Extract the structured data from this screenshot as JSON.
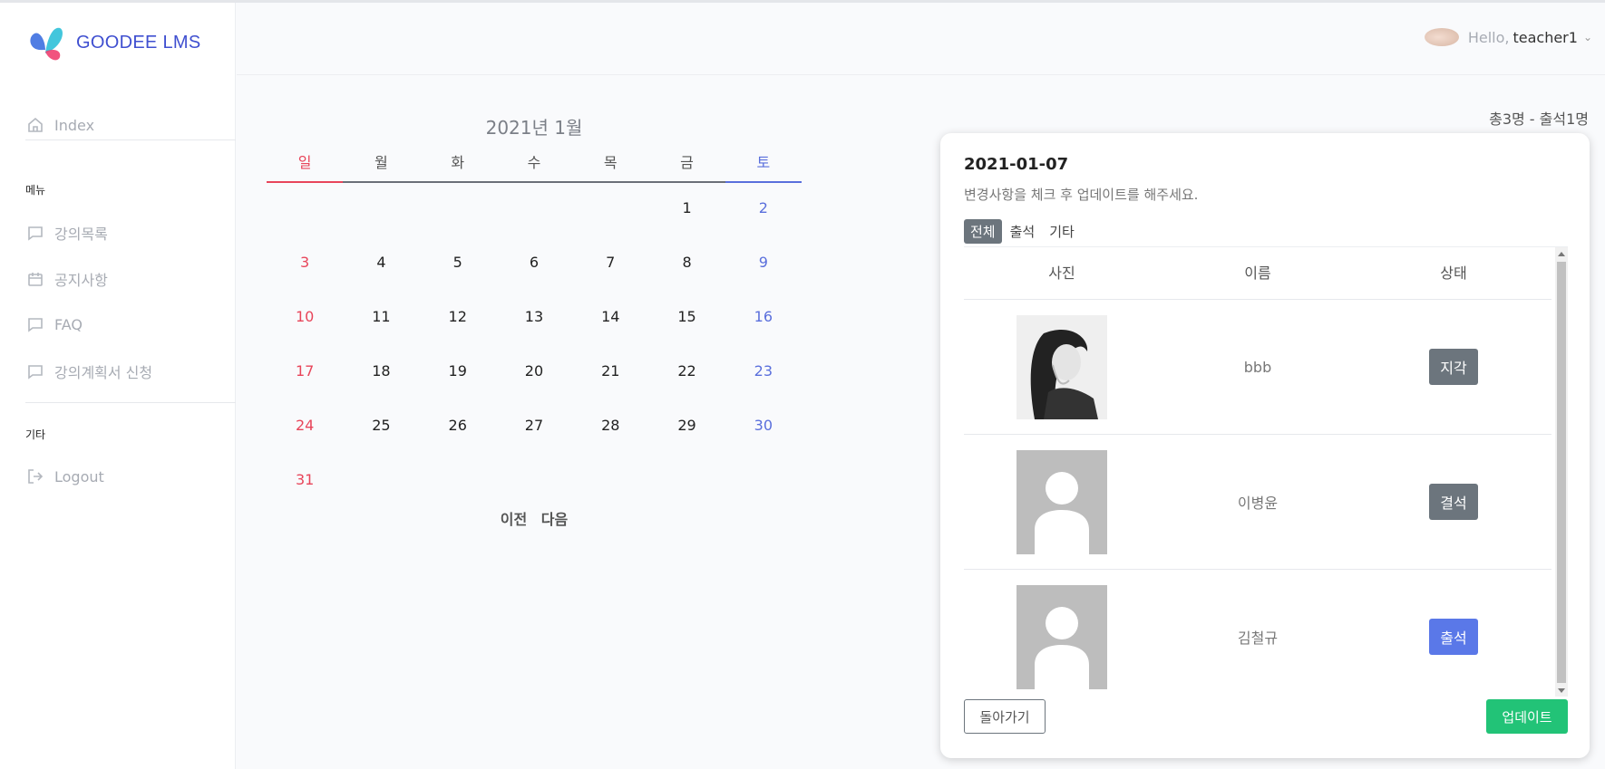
{
  "brand": {
    "name": "GOODEE LMS"
  },
  "sidebar": {
    "index_label": "Index",
    "section_menu": "메뉴",
    "menu_items": [
      {
        "label": "강의목록",
        "icon": "chat-icon"
      },
      {
        "label": "공지사항",
        "icon": "calendar-icon"
      },
      {
        "label": "FAQ",
        "icon": "chat-icon"
      },
      {
        "label": "강의계획서 신청",
        "icon": "chat-icon"
      }
    ],
    "section_etc": "기타",
    "logout_label": "Logout"
  },
  "header": {
    "hello": "Hello,",
    "username": "teacher1"
  },
  "calendar": {
    "title": "2021년 1월",
    "weekdays": [
      "일",
      "월",
      "화",
      "수",
      "목",
      "금",
      "토"
    ],
    "weeks": [
      [
        "",
        "",
        "",
        "",
        "",
        "1",
        "2"
      ],
      [
        "3",
        "4",
        "5",
        "6",
        "7",
        "8",
        "9"
      ],
      [
        "10",
        "11",
        "12",
        "13",
        "14",
        "15",
        "16"
      ],
      [
        "17",
        "18",
        "19",
        "20",
        "21",
        "22",
        "23"
      ],
      [
        "24",
        "25",
        "26",
        "27",
        "28",
        "29",
        "30"
      ],
      [
        "31",
        "",
        "",
        "",
        "",
        "",
        ""
      ]
    ],
    "prev_label": "이전",
    "next_label": "다음"
  },
  "summary": "총3명 - 출석1명",
  "panel": {
    "date": "2021-01-07",
    "description": "변경사항을 체크 후 업데이트를 해주세요.",
    "tabs": [
      "전체",
      "출석",
      "기타"
    ],
    "columns": [
      "사진",
      "이름",
      "상태"
    ],
    "rows": [
      {
        "name": "bbb",
        "status": "지각"
      },
      {
        "name": "이병윤",
        "status": "결석"
      },
      {
        "name": "김철규",
        "status": "출석"
      }
    ],
    "back_label": "돌아가기",
    "update_label": "업데이트"
  },
  "colors": {
    "brand": "#3f4fd0",
    "sunday": "#e8455a",
    "saturday": "#5a6fdc",
    "present": "#5a78e8",
    "update": "#22c377"
  }
}
